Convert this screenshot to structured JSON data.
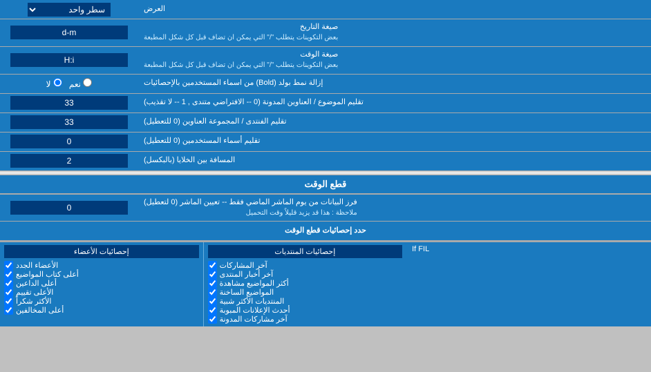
{
  "header": {
    "title": "العرض",
    "mode_label": "سطر واحد"
  },
  "rows": [
    {
      "id": "date_format",
      "label": "صيغة التاريخ",
      "sub_label": "بعض التكوينات يتطلب \"/\" التي يمكن ان تضاف قبل كل شكل المطبعة",
      "input_value": "d-m",
      "type": "input"
    },
    {
      "id": "time_format",
      "label": "صيغة الوقت",
      "sub_label": "بعض التكوينات يتطلب \"/\" التي يمكن ان تضاف قبل كل شكل المطبعة",
      "input_value": "H:i",
      "type": "input"
    },
    {
      "id": "bold_remove",
      "label": "إزالة نمط بولد (Bold) من اسماء المستخدمين بالإحصائيات",
      "radio_yes": "نعم",
      "radio_no": "لا",
      "selected": "no",
      "type": "radio"
    },
    {
      "id": "topic_title_limit",
      "label": "تقليم الموضوع / العناوين المدونة (0 -- الافتراضي متندى , 1 -- لا تقذيب)",
      "input_value": "33",
      "type": "input"
    },
    {
      "id": "forum_title_limit",
      "label": "تقليم الفنتدى / المجموعة العناوين (0 للتعطيل)",
      "input_value": "33",
      "type": "input"
    },
    {
      "id": "username_limit",
      "label": "تقليم أسماء المستخدمين (0 للتعطيل)",
      "input_value": "0",
      "type": "input"
    },
    {
      "id": "cell_gap",
      "label": "المسافة بين الخلايا (بالبكسل)",
      "input_value": "2",
      "type": "input"
    }
  ],
  "time_cut_section": {
    "header": "قطع الوقت",
    "row": {
      "id": "time_cut_days",
      "label": "فرز البيانات من يوم الماشر الماضي فقط -- تعيين الماشر (0 لتعطيل)",
      "sub_label": "ملاحظة : هذا قد يزيد قليلاً وقت التحميل",
      "input_value": "0",
      "type": "input"
    }
  },
  "stats_section": {
    "title": "حدد إحصائيات قطع الوقت",
    "col1_title": "إحصائيات المنتديات",
    "col1_items": [
      "آخر المشاركات",
      "آخر أخبار المنتدى",
      "أكثر المواضيع مشاهدة",
      "المواضيع الساخنة",
      "المنتديات الأكثر شبية",
      "أحدث الإعلانات المبوبة",
      "آخر مشاركات المدونة"
    ],
    "col2_title": "إحصائيات الأعضاء",
    "col2_items": [
      "الأعضاء الجدد",
      "أعلى كتاب المواضيع",
      "أعلى الداعين",
      "الأعلى تقييم",
      "الأكثر شكراً",
      "أعلى المخالفين"
    ],
    "col3_title": "",
    "blank_label": "If FIL"
  }
}
